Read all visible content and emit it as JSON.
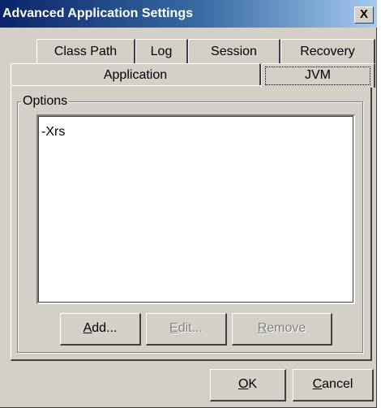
{
  "window": {
    "title": "Advanced Application Settings",
    "close_glyph": "X"
  },
  "tabs": {
    "row1": [
      {
        "label": "Class Path"
      },
      {
        "label": "Log"
      },
      {
        "label": "Session"
      },
      {
        "label": "Recovery"
      }
    ],
    "row2": [
      {
        "label": "Application",
        "selected": false
      },
      {
        "label": "JVM",
        "selected": true
      }
    ]
  },
  "options": {
    "group_label": "Options",
    "items": [
      "-Xrs"
    ]
  },
  "buttons": {
    "add": {
      "mnemonic": "A",
      "rest": "dd...",
      "enabled": true
    },
    "edit": {
      "mnemonic": "E",
      "rest": "dit...",
      "enabled": false
    },
    "remove": {
      "mnemonic": "R",
      "rest": "emove",
      "enabled": false
    },
    "ok": {
      "mnemonic": "O",
      "rest": "K",
      "enabled": true
    },
    "cancel": {
      "mnemonic": "C",
      "rest": "ancel",
      "enabled": true
    }
  }
}
